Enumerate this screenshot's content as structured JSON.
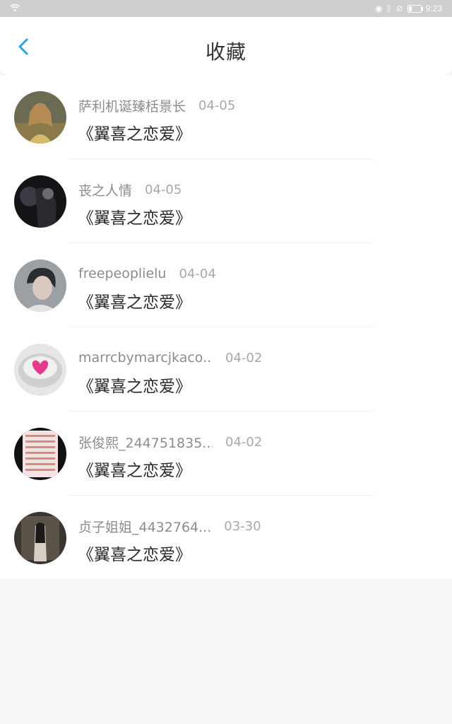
{
  "status_bar": {
    "time": "9:23",
    "icons": [
      "wifi-icon",
      "eye-icon",
      "bluetooth-icon",
      "mute-icon",
      "battery-icon"
    ]
  },
  "header": {
    "title": "收藏",
    "back_icon": "chevron-left-icon",
    "accent_color": "#2aa0e6"
  },
  "favorites": [
    {
      "user": "萨利机诞臻栝景长",
      "date": "04-05",
      "book": "《翼喜之恋爱》"
    },
    {
      "user": "丧之人情",
      "date": "04-05",
      "book": "《翼喜之恋爱》"
    },
    {
      "user": "freepeoplielu",
      "date": "04-04",
      "book": "《翼喜之恋爱》"
    },
    {
      "user": "marrcbymarcjkaco...",
      "date": "04-02",
      "book": "《翼喜之恋爱》"
    },
    {
      "user": "张俊熙_244751835...",
      "date": "04-02",
      "book": "《翼喜之恋爱》"
    },
    {
      "user": "贞子姐姐_4432764...",
      "date": "03-30",
      "book": "《翼喜之恋爱》"
    }
  ]
}
